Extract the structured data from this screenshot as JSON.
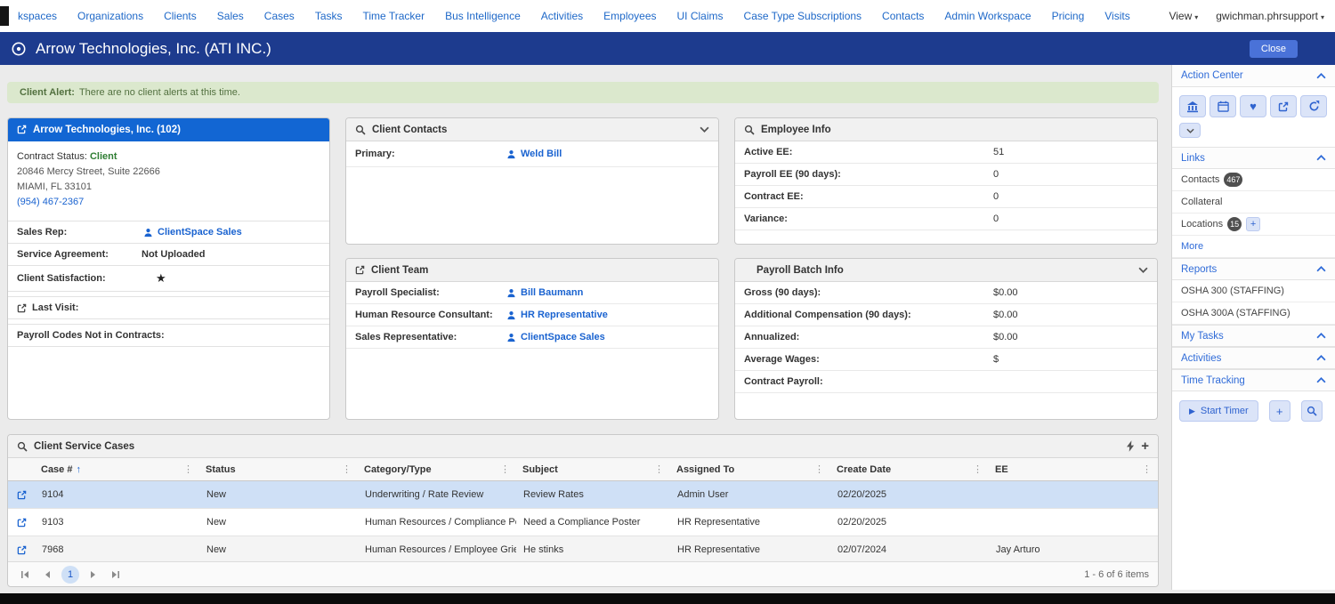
{
  "colors": {
    "appbar_blue": "#1d3b8e",
    "card_header_blue": "#1266d3",
    "link_blue": "#1a63d0",
    "nav_blue": "#1e68c8",
    "status_green": "#2e7d32",
    "alert_bg_green": "#dbe8cd",
    "selected_row_blue": "#cfe0f6",
    "sidebar_accent_blue": "#2f6bd8"
  },
  "icons": {
    "star": "★",
    "heart": "♥",
    "play": "▶",
    "plus": "+",
    "dots": "⋮",
    "sort_up": "↑",
    "caret_down": "▾"
  },
  "top_nav": {
    "items": [
      "kspaces",
      "Organizations",
      "Clients",
      "Sales",
      "Cases",
      "Tasks",
      "Time Tracker",
      "Bus Intelligence",
      "Activities",
      "Employees",
      "UI Claims",
      "Case Type Subscriptions",
      "Contacts",
      "Admin Workspace",
      "Pricing",
      "Visits"
    ],
    "view_label": "View",
    "user_label": "gwichman.phrsupport"
  },
  "header": {
    "title": "Arrow Technologies, Inc. (ATI INC.)",
    "close_label": "Close"
  },
  "alert": {
    "label": "Client Alert:",
    "text": "There are no client alerts at this time."
  },
  "client_card": {
    "title": "Arrow Technologies, Inc. (102)",
    "contract_status_label": "Contract Status:",
    "contract_status_value": "Client",
    "address_line1": "20846 Mercy Street, Suite 22666",
    "address_line2": "MIAMI, FL 33101",
    "phone": "(954) 467-2367",
    "sales_rep_label": "Sales Rep:",
    "sales_rep_value": "ClientSpace Sales",
    "service_agreement_label": "Service Agreement:",
    "service_agreement_value": "Not Uploaded",
    "client_satisfaction_label": "Client Satisfaction:",
    "last_visit_label": "Last Visit:",
    "payroll_codes_label": "Payroll Codes Not in Contracts:"
  },
  "client_contacts": {
    "title": "Client Contacts",
    "primary_label": "Primary:",
    "primary_value": "Weld Bill"
  },
  "client_team": {
    "title": "Client Team",
    "rows": [
      {
        "label": "Payroll Specialist:",
        "value": "Bill Baumann"
      },
      {
        "label": "Human Resource Consultant:",
        "value": "HR Representative"
      },
      {
        "label": "Sales Representative:",
        "value": "ClientSpace Sales"
      }
    ]
  },
  "employee_info": {
    "title": "Employee Info",
    "rows": [
      {
        "label": "Active EE:",
        "value": "51"
      },
      {
        "label": "Payroll EE (90 days):",
        "value": "0"
      },
      {
        "label": "Contract EE:",
        "value": "0"
      },
      {
        "label": "Variance:",
        "value": "0"
      }
    ]
  },
  "payroll_batch_info": {
    "title": "Payroll Batch Info",
    "rows": [
      {
        "label": "Gross (90 days):",
        "value": "$0.00"
      },
      {
        "label": "Additional Compensation (90 days):",
        "value": "$0.00"
      },
      {
        "label": "Annualized:",
        "value": "$0.00"
      },
      {
        "label": "Average Wages:",
        "value": "$"
      },
      {
        "label": "Contract Payroll:",
        "value": ""
      }
    ]
  },
  "cases": {
    "title": "Client Service Cases",
    "columns": [
      "Case #",
      "Status",
      "Category/Type",
      "Subject",
      "Assigned To",
      "Create Date",
      "EE"
    ],
    "rows": [
      {
        "case_number": "9104",
        "status": "New",
        "category": "Underwriting / Rate Review",
        "subject": "Review Rates",
        "assigned_to": "Admin User",
        "create_date": "02/20/2025",
        "ee": ""
      },
      {
        "case_number": "9103",
        "status": "New",
        "category": "Human Resources / Compliance Post...",
        "subject": "Need a Compliance Poster",
        "assigned_to": "HR Representative",
        "create_date": "02/20/2025",
        "ee": ""
      },
      {
        "case_number": "7968",
        "status": "New",
        "category": "Human Resources / Employee Grieva...",
        "subject": "He stinks",
        "assigned_to": "HR Representative",
        "create_date": "02/07/2024",
        "ee": "Jay Arturo"
      }
    ],
    "pagination": {
      "current_page": "1",
      "info": "1 - 6 of 6 items"
    }
  },
  "sidebar": {
    "action_center_label": "Action Center",
    "links_label": "Links",
    "contacts_label": "Contacts",
    "contacts_badge": "467",
    "collateral_label": "Collateral",
    "locations_label": "Locations",
    "locations_badge": "15",
    "more_label": "More",
    "reports_label": "Reports",
    "report_items": [
      "OSHA 300 (STAFFING)",
      "OSHA 300A (STAFFING)"
    ],
    "my_tasks_label": "My Tasks",
    "activities_label": "Activities",
    "time_tracking_label": "Time Tracking",
    "start_timer_label": "Start  Timer"
  }
}
